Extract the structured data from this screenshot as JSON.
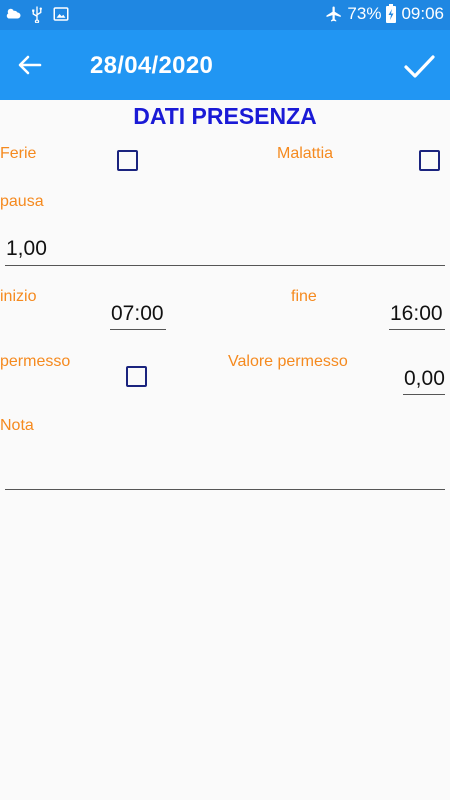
{
  "status_bar": {
    "battery": "73%",
    "time": "09:06",
    "icons": [
      "weather-cloud-icon",
      "usb-icon",
      "image-icon",
      "airplane-icon",
      "battery-charging-icon"
    ]
  },
  "app_bar": {
    "title": "28/04/2020",
    "back_icon": "arrow-left-icon",
    "confirm_icon": "check-icon"
  },
  "form": {
    "header": "DATI PRESENZA",
    "ferie_label": "Ferie",
    "ferie_checked": false,
    "malattia_label": "Malattia",
    "malattia_checked": false,
    "pausa_label": "pausa",
    "pausa_value": "1,00",
    "inizio_label": "inizio",
    "inizio_value": "07:00",
    "fine_label": "fine",
    "fine_value": "16:00",
    "permesso_label": "permesso",
    "permesso_checked": false,
    "valore_permesso_label": "Valore permesso",
    "valore_permesso_value": "0,00",
    "nota_label": "Nota",
    "nota_value": ""
  },
  "colors": {
    "status_bar": "#1f87e2",
    "app_bar": "#2196f3",
    "header_text": "#1a1ad6",
    "label_text": "#f58a1f",
    "checkbox_border": "#1a237e"
  }
}
